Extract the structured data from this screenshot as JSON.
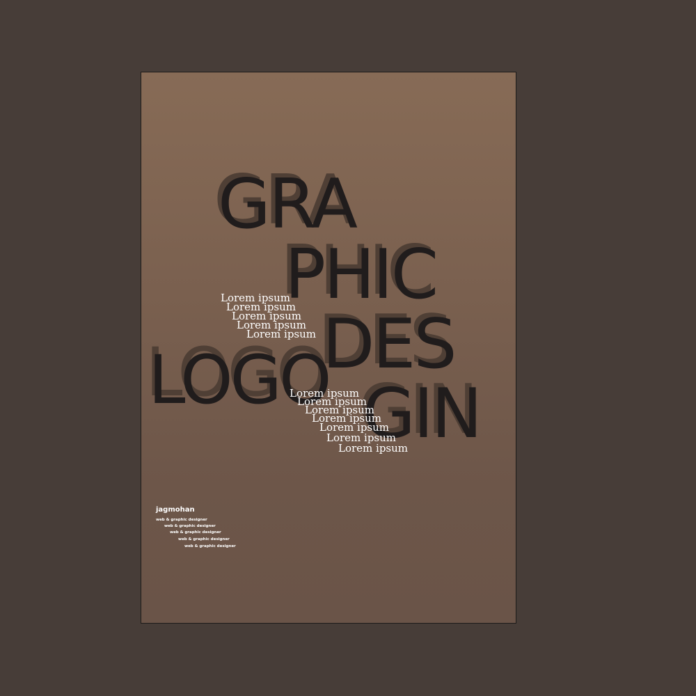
{
  "colors": {
    "background": "#473d38",
    "poster_top": "#876b56",
    "poster_bottom": "#6a5448",
    "headline": "#201c1c",
    "headline_shadow": "#4f3f35",
    "small_text": "#ffffff"
  },
  "poster": {
    "words": [
      "GRA",
      "PHIC",
      "DES",
      "GIN",
      "LOGO"
    ],
    "lorem_group_1": [
      "Lorem ipsum",
      "Lorem ipsum",
      "Lorem ipsum",
      "Lorem ipsum",
      "Lorem ipsum"
    ],
    "lorem_group_2": [
      "Lorem ipsum",
      "Lorem ipsum",
      "Lorem ipsum",
      "Lorem ipsum",
      "Lorem ipsum",
      "Lorem ipsum",
      "Lorem ipsum"
    ],
    "credit": {
      "name": "jagmohan",
      "roles": [
        "web & graphic designer",
        "web & graphic designer",
        "web & graphic designer",
        "web & graphic designer",
        "web & graphic designer"
      ]
    }
  }
}
